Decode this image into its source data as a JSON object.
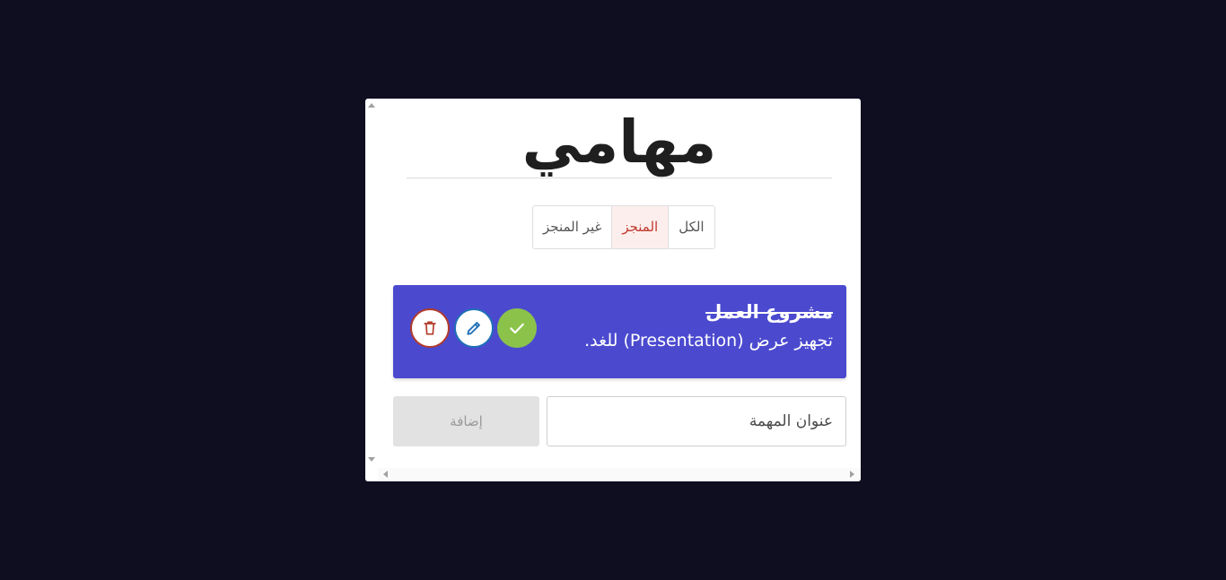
{
  "app": {
    "title": "مهامي"
  },
  "filters": {
    "items": [
      {
        "label": "الكل",
        "active": false
      },
      {
        "label": "المنجز",
        "active": true
      },
      {
        "label": "غير المنجز",
        "active": false
      }
    ]
  },
  "tasks": [
    {
      "title": "مشروع العمل",
      "description": "تجهيز عرض (Presentation) للغد.",
      "completed": true,
      "actions": {
        "done_icon": "check-icon",
        "edit_icon": "pencil-icon",
        "delete_icon": "trash-icon"
      }
    }
  ],
  "add_form": {
    "placeholder": "عنوان المهمة",
    "button_label": "إضافة"
  },
  "colors": {
    "background": "#0f0d20",
    "task_card": "#4b4acf",
    "done_button": "#8bc34a",
    "edit_button_border": "#1e6fb8",
    "delete_button_border": "#b23a2a",
    "active_filter_text": "#c0392b",
    "active_filter_bg": "#fdeeee"
  }
}
